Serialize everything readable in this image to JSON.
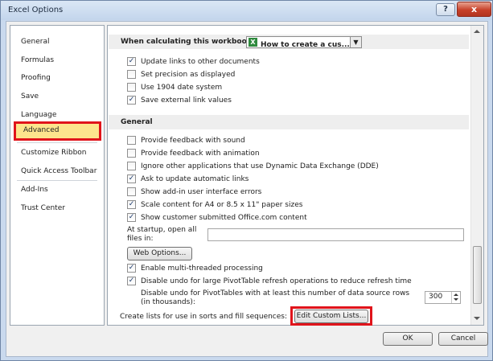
{
  "window": {
    "title": "Excel Options",
    "help_icon": "?",
    "close_icon": "x"
  },
  "nav": {
    "items": [
      {
        "label": "General"
      },
      {
        "label": "Formulas"
      },
      {
        "label": "Proofing"
      },
      {
        "label": "Save"
      },
      {
        "label": "Language"
      },
      {
        "label": "Advanced",
        "selected": true
      },
      {
        "label": "Customize Ribbon"
      },
      {
        "label": "Quick Access Toolbar"
      },
      {
        "label": "Add-Ins"
      },
      {
        "label": "Trust Center"
      }
    ]
  },
  "workbook": {
    "label": "When calculating this workbook:",
    "dropdown_value": "How to create a cus...",
    "options": [
      {
        "label": "Update links to other documents",
        "checked": true
      },
      {
        "label": "Set precision as displayed",
        "checked": false
      },
      {
        "label": "Use 1904 date system",
        "checked": false
      },
      {
        "label": "Save external link values",
        "checked": true
      }
    ]
  },
  "general": {
    "header": "General",
    "options": [
      {
        "label": "Provide feedback with sound",
        "checked": false
      },
      {
        "label": "Provide feedback with animation",
        "checked": false
      },
      {
        "label": "Ignore other applications that use Dynamic Data Exchange (DDE)",
        "checked": false
      },
      {
        "label": "Ask to update automatic links",
        "checked": true
      },
      {
        "label": "Show add-in user interface errors",
        "checked": false
      },
      {
        "label": "Scale content for A4 or 8.5 x 11\" paper sizes",
        "checked": true
      },
      {
        "label": "Show customer submitted Office.com content",
        "checked": true
      }
    ],
    "startup_label": "At startup, open all files in:",
    "startup_value": "",
    "web_options_button": "Web Options...",
    "options2": [
      {
        "label": "Enable multi-threaded processing",
        "checked": true
      },
      {
        "label": "Disable undo for large PivotTable refresh operations to reduce refresh time",
        "checked": true
      }
    ],
    "undo_rows_label": "Disable undo for PivotTables with at least this number of data source rows (in thousands):",
    "undo_rows_value": "300",
    "lists_label": "Create lists for use in sorts and fill sequences:",
    "edit_lists_button": "Edit Custom Lists..."
  },
  "footer": {
    "ok": "OK",
    "cancel": "Cancel"
  },
  "colors": {
    "highlight_red": "#e0141b",
    "selected_bg": "#fde58d",
    "excel_green": "#2f8a3e"
  }
}
